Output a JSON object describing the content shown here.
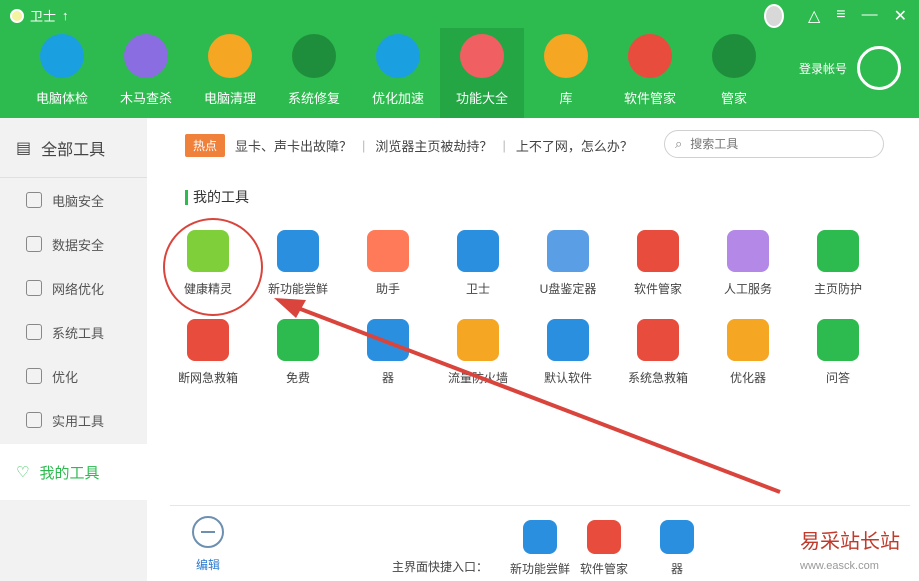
{
  "window": {
    "title": "卫士",
    "controls": [
      "shirt-icon",
      "menu-icon",
      "minimize-icon",
      "close-icon"
    ]
  },
  "nav": [
    {
      "label": "电脑体检",
      "icon": "monitor-icon",
      "color": "#1a9fe0"
    },
    {
      "label": "木马查杀",
      "icon": "horse-icon",
      "color": "#8a6de0"
    },
    {
      "label": "电脑清理",
      "icon": "broom-icon",
      "color": "#f5a623"
    },
    {
      "label": "系统修复",
      "icon": "shield-icon",
      "color": "#1f8e3c"
    },
    {
      "label": "优化加速",
      "icon": "rocket-icon",
      "color": "#1a9fe0"
    },
    {
      "label": "功能大全",
      "icon": "grid-icon",
      "color": "#f06062",
      "active": true
    },
    {
      "label": "库",
      "icon": "box-icon",
      "color": "#f5a623"
    },
    {
      "label": "软件管家",
      "icon": "apps-icon",
      "color": "#e84c3d"
    },
    {
      "label": "管家",
      "icon": "phone-icon",
      "color": "#1f8e3c"
    }
  ],
  "account": {
    "label": "登录帐号"
  },
  "sidebar": {
    "header": "全部工具",
    "items": [
      {
        "label": "电脑安全"
      },
      {
        "label": "数据安全"
      },
      {
        "label": "网络优化"
      },
      {
        "label": "系统工具"
      },
      {
        "label": "优化"
      },
      {
        "label": "实用工具"
      }
    ],
    "my_tools": "我的工具"
  },
  "hot": {
    "badge": "热点",
    "links": [
      "显卡、声卡出故障？",
      "浏览器主页被劫持？",
      "上不了网，怎么办？"
    ]
  },
  "search": {
    "placeholder": "搜索工具"
  },
  "section_title": "我的工具",
  "tools": [
    {
      "label": "健康精灵",
      "color": "#7fcf3b"
    },
    {
      "label": "新功能尝鲜",
      "color": "#2b8fe0"
    },
    {
      "label": "助手",
      "color": "#ff7a59"
    },
    {
      "label": "卫士",
      "color": "#2b8fe0"
    },
    {
      "label": "U盘鉴定器",
      "color": "#5a9ee6"
    },
    {
      "label": "软件管家",
      "color": "#e84c3d"
    },
    {
      "label": "人工服务",
      "color": "#b388e6"
    },
    {
      "label": "主页防护",
      "color": "#2dbb4f"
    },
    {
      "label": "断网急救箱",
      "color": "#e84c3d"
    },
    {
      "label": "免费",
      "color": "#2dbb4f"
    },
    {
      "label": "器",
      "color": "#2b8fe0"
    },
    {
      "label": "流量防火墙",
      "color": "#f5a623"
    },
    {
      "label": "默认软件",
      "color": "#2b8fe0"
    },
    {
      "label": "系统急救箱",
      "color": "#e84c3d"
    },
    {
      "label": "优化器",
      "color": "#f5a623"
    },
    {
      "label": "问答",
      "color": "#2dbb4f"
    }
  ],
  "bottom": {
    "edit": "编辑",
    "quick_label": "主界面快捷入口：",
    "quick": [
      {
        "label": "新功能尝鲜",
        "color": "#2b8fe0"
      },
      {
        "label": "软件管家",
        "color": "#e84c3d"
      },
      {
        "label": "器",
        "color": "#2b8fe0"
      }
    ]
  },
  "watermark": {
    "text": "易采站长站",
    "url": "www.easck.com"
  }
}
